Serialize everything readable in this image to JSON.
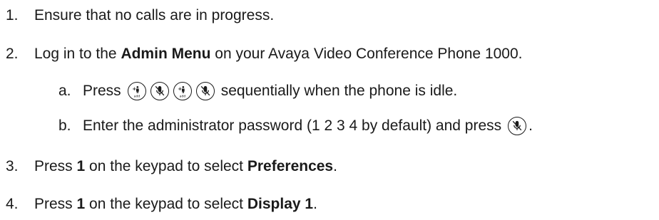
{
  "steps": [
    {
      "num": "1.",
      "text": "Ensure that no calls are in progress."
    },
    {
      "num": "2.",
      "pre": "Log in to the ",
      "bold": "Admin Menu",
      "post": " on your Avaya Video Conference Phone 1000.",
      "substeps": [
        {
          "letter": "a.",
          "pre": "Press",
          "post": "sequentially when the phone is idle.",
          "buttons": [
            "add-icon",
            "mute-icon",
            "add-icon",
            "mute-icon"
          ]
        },
        {
          "letter": "b.",
          "pre": "Enter the administrator password (1 2 3 4 by default) and press",
          "post": ".",
          "buttons": [
            "mute-icon"
          ]
        }
      ]
    },
    {
      "num": "3.",
      "pre": "Press ",
      "bold1": "1",
      "mid": " on the keypad to select ",
      "bold2": "Preferences",
      "post": "."
    },
    {
      "num": "4.",
      "pre": "Press ",
      "bold1": "1",
      "mid": " on the keypad to select ",
      "bold2": "Display 1",
      "post": "."
    }
  ],
  "icons": {
    "add_label": "add"
  }
}
